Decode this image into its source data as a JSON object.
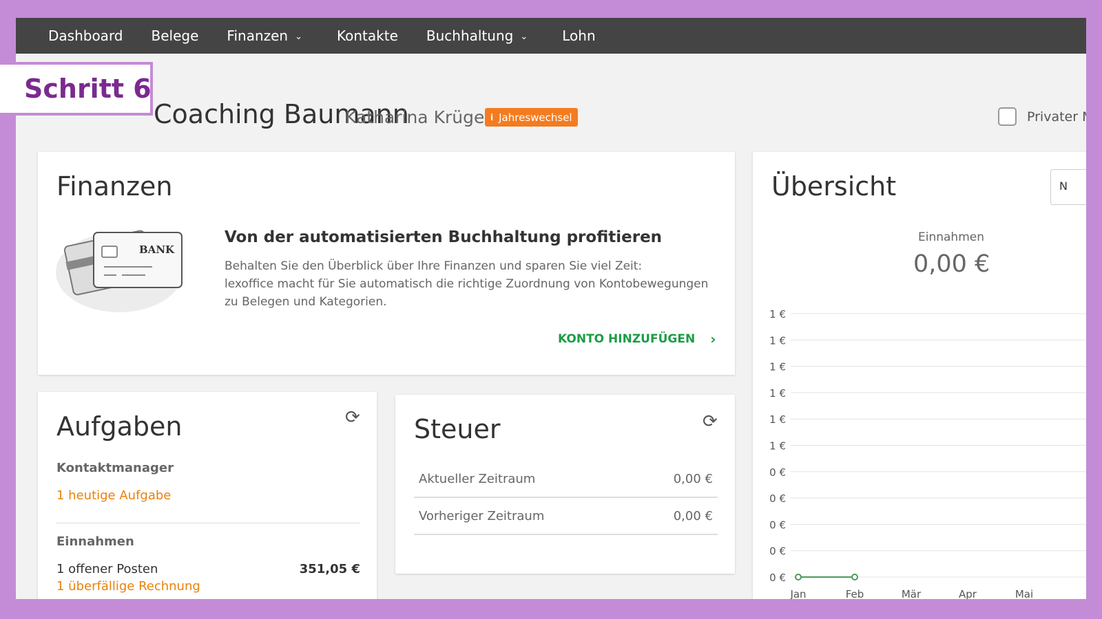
{
  "overlay": {
    "step_label": "Schritt 6"
  },
  "nav": {
    "items": [
      {
        "label": "Dashboard",
        "dropdown": false
      },
      {
        "label": "Belege",
        "dropdown": false
      },
      {
        "label": "Finanzen",
        "dropdown": true
      },
      {
        "label": "Kontakte",
        "dropdown": false
      },
      {
        "label": "Buchhaltung",
        "dropdown": true
      },
      {
        "label": "Lohn",
        "dropdown": false
      }
    ]
  },
  "header": {
    "company": "Coaching Baumann",
    "person": "Katharina Krüger",
    "badge": "Jahreswechsel",
    "badge_icon": "i",
    "private_label": "Privater M"
  },
  "finanzen": {
    "title": "Finanzen",
    "bank_label": "BANK",
    "headline": "Von der automatisierten Buchhaltung profitieren",
    "text_lines": [
      "Behalten Sie den Überblick über Ihre Finanzen und sparen Sie viel Zeit:",
      "lexoffice macht für Sie automatisch die richtige Zuordnung von Kontobewegungen",
      "zu Belegen und Kategorien."
    ],
    "link": "KONTO HINZUFÜGEN"
  },
  "aufgaben": {
    "title": "Aufgaben",
    "section1": "Kontaktmanager",
    "link1": "1 heutige Aufgabe",
    "section2": "Einnahmen",
    "row_label": "1  offener Posten",
    "row_amount": "351,05 €",
    "link2": "1 überfällige Rechnung"
  },
  "steuer": {
    "title": "Steuer",
    "rows": [
      {
        "label": "Aktueller Zeitraum",
        "value": "0,00 €"
      },
      {
        "label": "Vorheriger Zeitraum",
        "value": "0,00 €"
      }
    ]
  },
  "uebersicht": {
    "title": "Übersicht",
    "button_label": "N",
    "label": "Einnahmen",
    "value": "0,00 €"
  },
  "chart_data": {
    "type": "line",
    "title": "",
    "categories": [
      "Jan",
      "Feb",
      "Mär",
      "Apr",
      "Mai"
    ],
    "y_tick_labels": [
      "1 €",
      "1 €",
      "1 €",
      "1 €",
      "1 €",
      "1 €",
      "0 €",
      "0 €",
      "0 €",
      "0 €",
      "0 €"
    ],
    "series": [
      {
        "values": [
          0,
          0
        ],
        "color": "#4a9a5c"
      }
    ],
    "ylim": [
      0,
      1
    ],
    "grid": true
  }
}
